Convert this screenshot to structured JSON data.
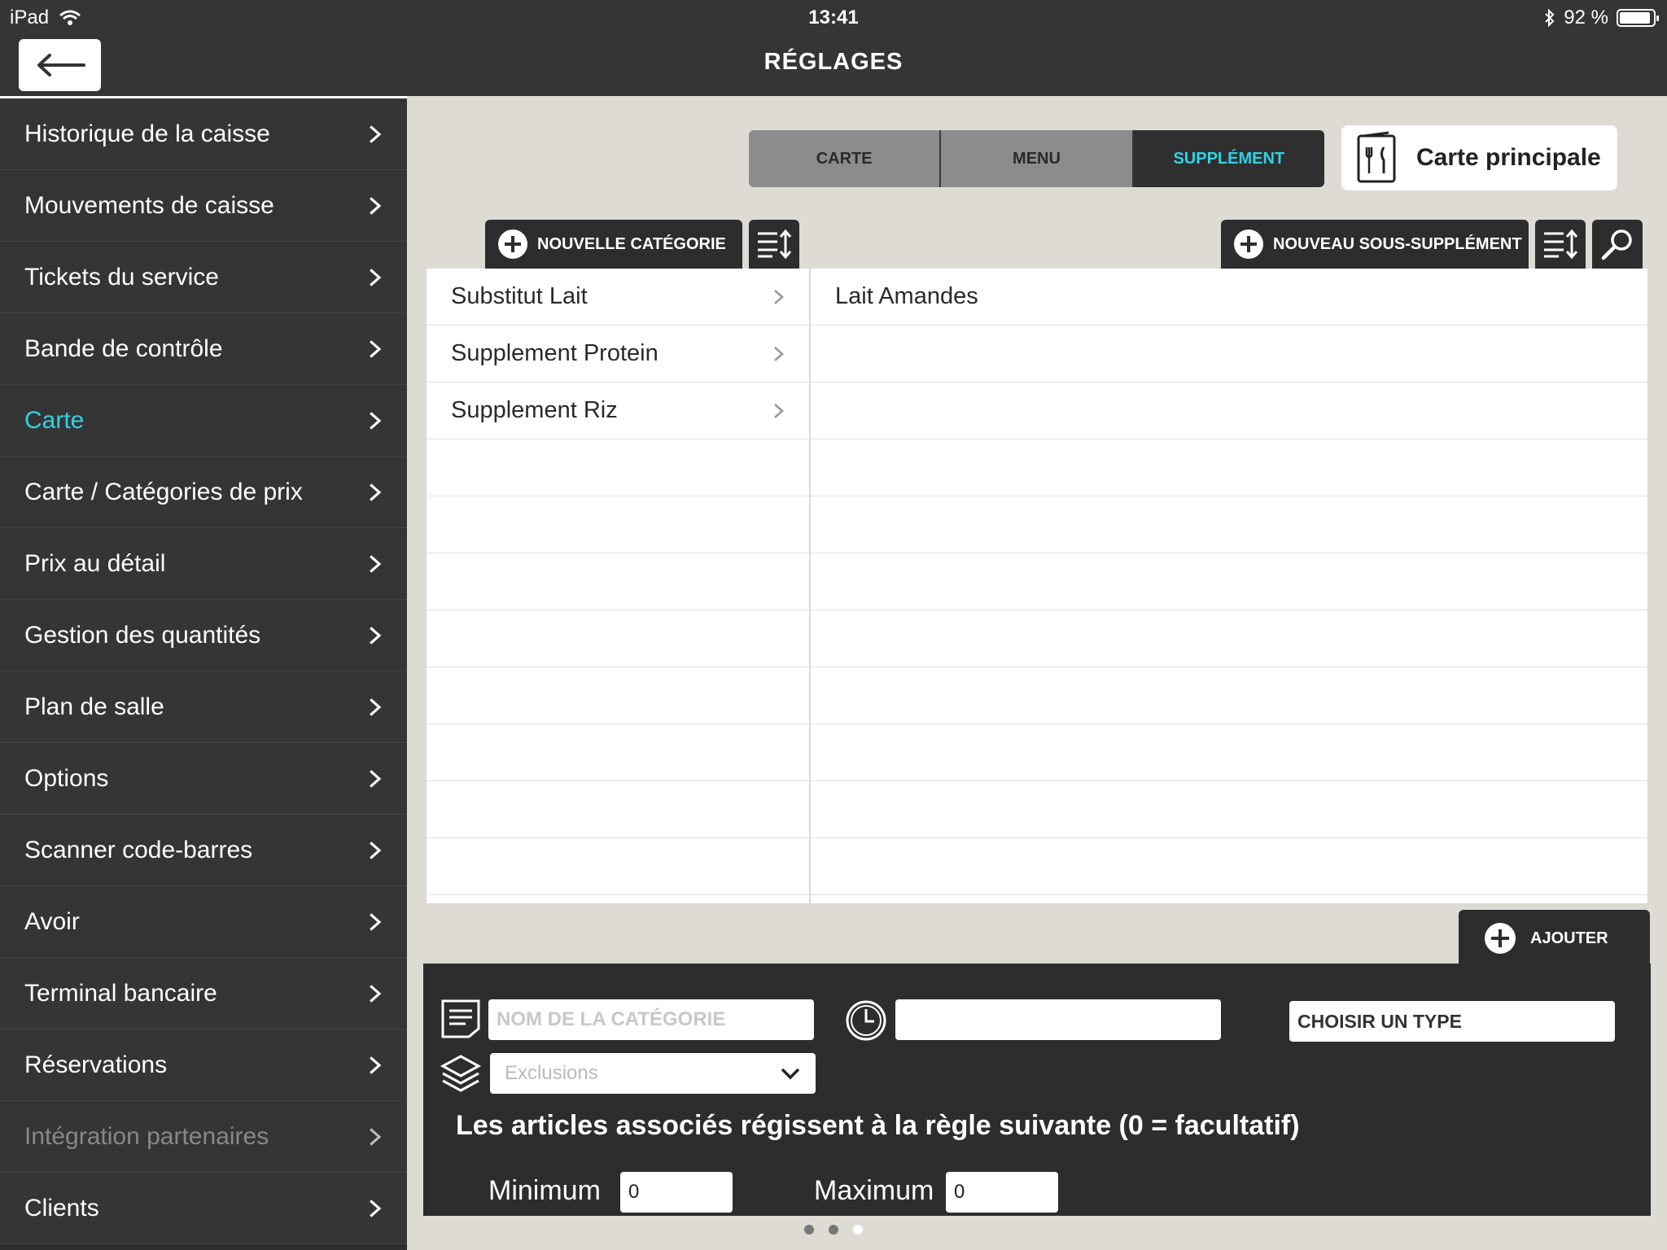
{
  "status": {
    "device": "iPad",
    "time": "13:41",
    "battery": "92 %",
    "battery_level": 0.92
  },
  "header": {
    "title": "RÉGLAGES"
  },
  "sidebar": {
    "items": [
      {
        "label": "Historique de la caisse"
      },
      {
        "label": "Mouvements de caisse"
      },
      {
        "label": "Tickets du service"
      },
      {
        "label": "Bande de contrôle"
      },
      {
        "label": "Carte",
        "active": true
      },
      {
        "label": "Carte / Catégories de prix"
      },
      {
        "label": "Prix au détail"
      },
      {
        "label": "Gestion des quantités"
      },
      {
        "label": "Plan de salle"
      },
      {
        "label": "Options"
      },
      {
        "label": "Scanner code-barres"
      },
      {
        "label": "Avoir"
      },
      {
        "label": "Terminal bancaire"
      },
      {
        "label": "Réservations"
      },
      {
        "label": "Intégration partenaires",
        "disabled": true
      },
      {
        "label": "Clients"
      }
    ]
  },
  "tabs": {
    "carte": "CARTE",
    "menu": "MENU",
    "supplement": "SUPPLÉMENT"
  },
  "menu_card": {
    "label": "Carte principale"
  },
  "toolbar": {
    "new_category": "NOUVELLE CATÉGORIE",
    "new_sub_supplement": "NOUVEAU SOUS-SUPPLÉMENT"
  },
  "categories": [
    "Substitut Lait",
    "Supplement Protein",
    "Supplement Riz"
  ],
  "sub_supplements": [
    "Lait Amandes"
  ],
  "form": {
    "add_label": "AJOUTER",
    "category_name_placeholder": "NOM DE LA CATÉGORIE",
    "exclusions_placeholder": "Exclusions",
    "type_placeholder": "CHOISIR UN TYPE",
    "rule_text": "Les articles associés régissent à la règle suivante (0 = facultatif)",
    "minimum_label": "Minimum",
    "minimum_value": "0",
    "maximum_label": "Maximum",
    "maximum_value": "0"
  },
  "colors": {
    "accent": "#2fd3e6",
    "dark": "#2d2d2d",
    "background": "#dedad4"
  }
}
